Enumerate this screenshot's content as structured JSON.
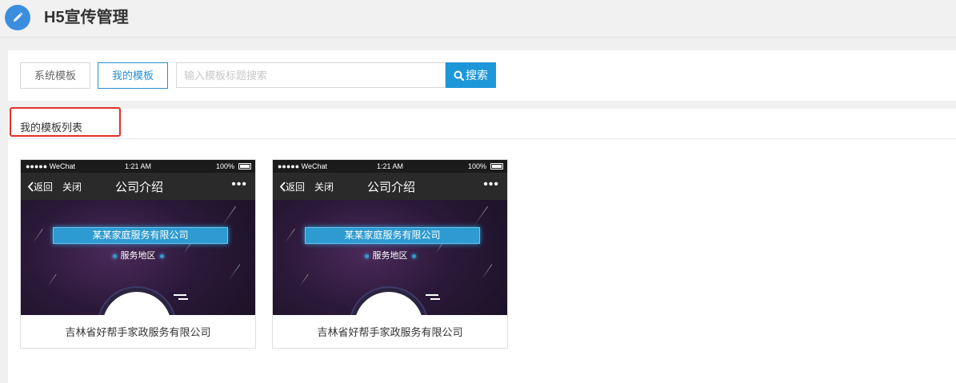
{
  "header": {
    "title": "H5宣传管理",
    "icon": "pencil-icon",
    "icon_bg": "#3c8dde"
  },
  "toolbar": {
    "tab_system": "系统模板",
    "tab_mine": "我的模板",
    "search_placeholder": "输入模板标题搜索",
    "search_value": "",
    "search_button": "搜索",
    "accent": "#1e97d9"
  },
  "list": {
    "heading": "我的模板列表",
    "highlight_color": "#e0302a",
    "cards": [
      {
        "title": "吉林省好帮手家政服务有限公司",
        "preview": {
          "carrier": "●●●●● WeChat",
          "time": "1:21 AM",
          "battery": "100%",
          "back": "返回",
          "close": "关闭",
          "page_title": "公司介绍",
          "more": "•••",
          "company": "某某家庭服务有限公司",
          "region": "服务地区"
        }
      },
      {
        "title": "吉林省好帮手家政服务有限公司",
        "preview": {
          "carrier": "●●●●● WeChat",
          "time": "1:21 AM",
          "battery": "100%",
          "back": "返回",
          "close": "关闭",
          "page_title": "公司介绍",
          "more": "•••",
          "company": "某某家庭服务有限公司",
          "region": "服务地区"
        }
      }
    ]
  }
}
